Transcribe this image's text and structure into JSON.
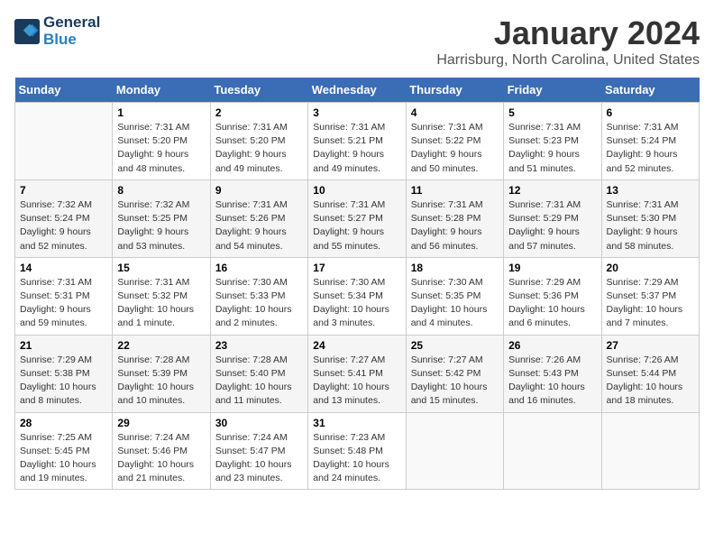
{
  "header": {
    "logo_line1": "General",
    "logo_line2": "Blue",
    "month": "January 2024",
    "location": "Harrisburg, North Carolina, United States"
  },
  "weekdays": [
    "Sunday",
    "Monday",
    "Tuesday",
    "Wednesday",
    "Thursday",
    "Friday",
    "Saturday"
  ],
  "weeks": [
    [
      {
        "day": "",
        "sunrise": "",
        "sunset": "",
        "daylight": ""
      },
      {
        "day": "1",
        "sunrise": "Sunrise: 7:31 AM",
        "sunset": "Sunset: 5:20 PM",
        "daylight": "Daylight: 9 hours and 48 minutes."
      },
      {
        "day": "2",
        "sunrise": "Sunrise: 7:31 AM",
        "sunset": "Sunset: 5:20 PM",
        "daylight": "Daylight: 9 hours and 49 minutes."
      },
      {
        "day": "3",
        "sunrise": "Sunrise: 7:31 AM",
        "sunset": "Sunset: 5:21 PM",
        "daylight": "Daylight: 9 hours and 49 minutes."
      },
      {
        "day": "4",
        "sunrise": "Sunrise: 7:31 AM",
        "sunset": "Sunset: 5:22 PM",
        "daylight": "Daylight: 9 hours and 50 minutes."
      },
      {
        "day": "5",
        "sunrise": "Sunrise: 7:31 AM",
        "sunset": "Sunset: 5:23 PM",
        "daylight": "Daylight: 9 hours and 51 minutes."
      },
      {
        "day": "6",
        "sunrise": "Sunrise: 7:31 AM",
        "sunset": "Sunset: 5:24 PM",
        "daylight": "Daylight: 9 hours and 52 minutes."
      }
    ],
    [
      {
        "day": "7",
        "sunrise": "Sunrise: 7:32 AM",
        "sunset": "Sunset: 5:24 PM",
        "daylight": "Daylight: 9 hours and 52 minutes."
      },
      {
        "day": "8",
        "sunrise": "Sunrise: 7:32 AM",
        "sunset": "Sunset: 5:25 PM",
        "daylight": "Daylight: 9 hours and 53 minutes."
      },
      {
        "day": "9",
        "sunrise": "Sunrise: 7:31 AM",
        "sunset": "Sunset: 5:26 PM",
        "daylight": "Daylight: 9 hours and 54 minutes."
      },
      {
        "day": "10",
        "sunrise": "Sunrise: 7:31 AM",
        "sunset": "Sunset: 5:27 PM",
        "daylight": "Daylight: 9 hours and 55 minutes."
      },
      {
        "day": "11",
        "sunrise": "Sunrise: 7:31 AM",
        "sunset": "Sunset: 5:28 PM",
        "daylight": "Daylight: 9 hours and 56 minutes."
      },
      {
        "day": "12",
        "sunrise": "Sunrise: 7:31 AM",
        "sunset": "Sunset: 5:29 PM",
        "daylight": "Daylight: 9 hours and 57 minutes."
      },
      {
        "day": "13",
        "sunrise": "Sunrise: 7:31 AM",
        "sunset": "Sunset: 5:30 PM",
        "daylight": "Daylight: 9 hours and 58 minutes."
      }
    ],
    [
      {
        "day": "14",
        "sunrise": "Sunrise: 7:31 AM",
        "sunset": "Sunset: 5:31 PM",
        "daylight": "Daylight: 9 hours and 59 minutes."
      },
      {
        "day": "15",
        "sunrise": "Sunrise: 7:31 AM",
        "sunset": "Sunset: 5:32 PM",
        "daylight": "Daylight: 10 hours and 1 minute."
      },
      {
        "day": "16",
        "sunrise": "Sunrise: 7:30 AM",
        "sunset": "Sunset: 5:33 PM",
        "daylight": "Daylight: 10 hours and 2 minutes."
      },
      {
        "day": "17",
        "sunrise": "Sunrise: 7:30 AM",
        "sunset": "Sunset: 5:34 PM",
        "daylight": "Daylight: 10 hours and 3 minutes."
      },
      {
        "day": "18",
        "sunrise": "Sunrise: 7:30 AM",
        "sunset": "Sunset: 5:35 PM",
        "daylight": "Daylight: 10 hours and 4 minutes."
      },
      {
        "day": "19",
        "sunrise": "Sunrise: 7:29 AM",
        "sunset": "Sunset: 5:36 PM",
        "daylight": "Daylight: 10 hours and 6 minutes."
      },
      {
        "day": "20",
        "sunrise": "Sunrise: 7:29 AM",
        "sunset": "Sunset: 5:37 PM",
        "daylight": "Daylight: 10 hours and 7 minutes."
      }
    ],
    [
      {
        "day": "21",
        "sunrise": "Sunrise: 7:29 AM",
        "sunset": "Sunset: 5:38 PM",
        "daylight": "Daylight: 10 hours and 8 minutes."
      },
      {
        "day": "22",
        "sunrise": "Sunrise: 7:28 AM",
        "sunset": "Sunset: 5:39 PM",
        "daylight": "Daylight: 10 hours and 10 minutes."
      },
      {
        "day": "23",
        "sunrise": "Sunrise: 7:28 AM",
        "sunset": "Sunset: 5:40 PM",
        "daylight": "Daylight: 10 hours and 11 minutes."
      },
      {
        "day": "24",
        "sunrise": "Sunrise: 7:27 AM",
        "sunset": "Sunset: 5:41 PM",
        "daylight": "Daylight: 10 hours and 13 minutes."
      },
      {
        "day": "25",
        "sunrise": "Sunrise: 7:27 AM",
        "sunset": "Sunset: 5:42 PM",
        "daylight": "Daylight: 10 hours and 15 minutes."
      },
      {
        "day": "26",
        "sunrise": "Sunrise: 7:26 AM",
        "sunset": "Sunset: 5:43 PM",
        "daylight": "Daylight: 10 hours and 16 minutes."
      },
      {
        "day": "27",
        "sunrise": "Sunrise: 7:26 AM",
        "sunset": "Sunset: 5:44 PM",
        "daylight": "Daylight: 10 hours and 18 minutes."
      }
    ],
    [
      {
        "day": "28",
        "sunrise": "Sunrise: 7:25 AM",
        "sunset": "Sunset: 5:45 PM",
        "daylight": "Daylight: 10 hours and 19 minutes."
      },
      {
        "day": "29",
        "sunrise": "Sunrise: 7:24 AM",
        "sunset": "Sunset: 5:46 PM",
        "daylight": "Daylight: 10 hours and 21 minutes."
      },
      {
        "day": "30",
        "sunrise": "Sunrise: 7:24 AM",
        "sunset": "Sunset: 5:47 PM",
        "daylight": "Daylight: 10 hours and 23 minutes."
      },
      {
        "day": "31",
        "sunrise": "Sunrise: 7:23 AM",
        "sunset": "Sunset: 5:48 PM",
        "daylight": "Daylight: 10 hours and 24 minutes."
      },
      {
        "day": "",
        "sunrise": "",
        "sunset": "",
        "daylight": ""
      },
      {
        "day": "",
        "sunrise": "",
        "sunset": "",
        "daylight": ""
      },
      {
        "day": "",
        "sunrise": "",
        "sunset": "",
        "daylight": ""
      }
    ]
  ]
}
